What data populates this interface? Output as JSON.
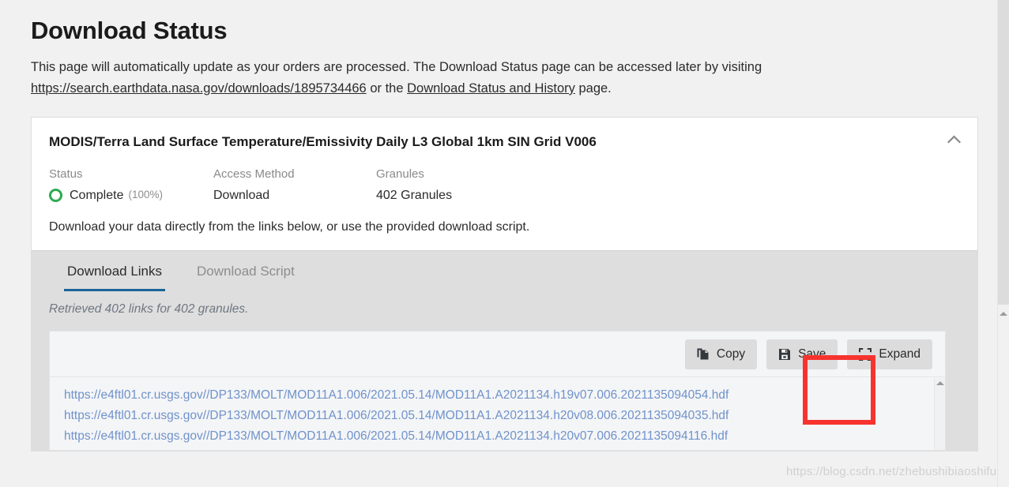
{
  "page": {
    "title": "Download Status",
    "intro_part1": "This page will automatically update as your orders are processed. The Download Status page can be accessed later by visiting ",
    "intro_link_url": "https://search.earthdata.nasa.gov/downloads/1895734466",
    "intro_part2": " or the ",
    "intro_link_history": "Download Status and History",
    "intro_part3": " page.",
    "background_color": "#f1f1f1"
  },
  "order_card": {
    "dataset_title": "MODIS/Terra Land Surface Temperature/Emissivity Daily L3 Global 1km SIN Grid V006",
    "collapse_icon": "chevron-up-icon",
    "meta": {
      "status_label": "Status",
      "status_value": "Complete",
      "status_percent": "(100%)",
      "status_color": "#2eaa52",
      "access_label": "Access Method",
      "access_value": "Download",
      "granules_label": "Granules",
      "granules_value": "402 Granules"
    },
    "note": "Download your data directly from the links below, or use the provided download script."
  },
  "tabs": [
    {
      "label": "Download Links",
      "active": true
    },
    {
      "label": "Download Script",
      "active": false
    }
  ],
  "tab_accent_color": "#1a6496",
  "links_panel": {
    "retrieved_note": "Retrieved 402 links for 402 granules.",
    "toolbar": [
      {
        "label": "Copy",
        "icon": "copy-icon"
      },
      {
        "label": "Save",
        "icon": "save-floppy-icon"
      },
      {
        "label": "Expand",
        "icon": "expand-icon"
      }
    ],
    "links": [
      "https://e4ftl01.cr.usgs.gov//DP133/MOLT/MOD11A1.006/2021.05.14/MOD11A1.A2021134.h19v07.006.2021135094054.hdf",
      "https://e4ftl01.cr.usgs.gov//DP133/MOLT/MOD11A1.006/2021.05.14/MOD11A1.A2021134.h20v08.006.2021135094035.hdf",
      "https://e4ftl01.cr.usgs.gov//DP133/MOLT/MOD11A1.006/2021.05.14/MOD11A1.A2021134.h20v07.006.2021135094116.hdf"
    ],
    "link_color": "#6f92cc"
  },
  "annotation": {
    "highlight_target": "Save",
    "highlight_color": "#f7332f"
  },
  "watermark": {
    "text": "https://blog.csdn.net/zhebushibiaoshifu"
  }
}
